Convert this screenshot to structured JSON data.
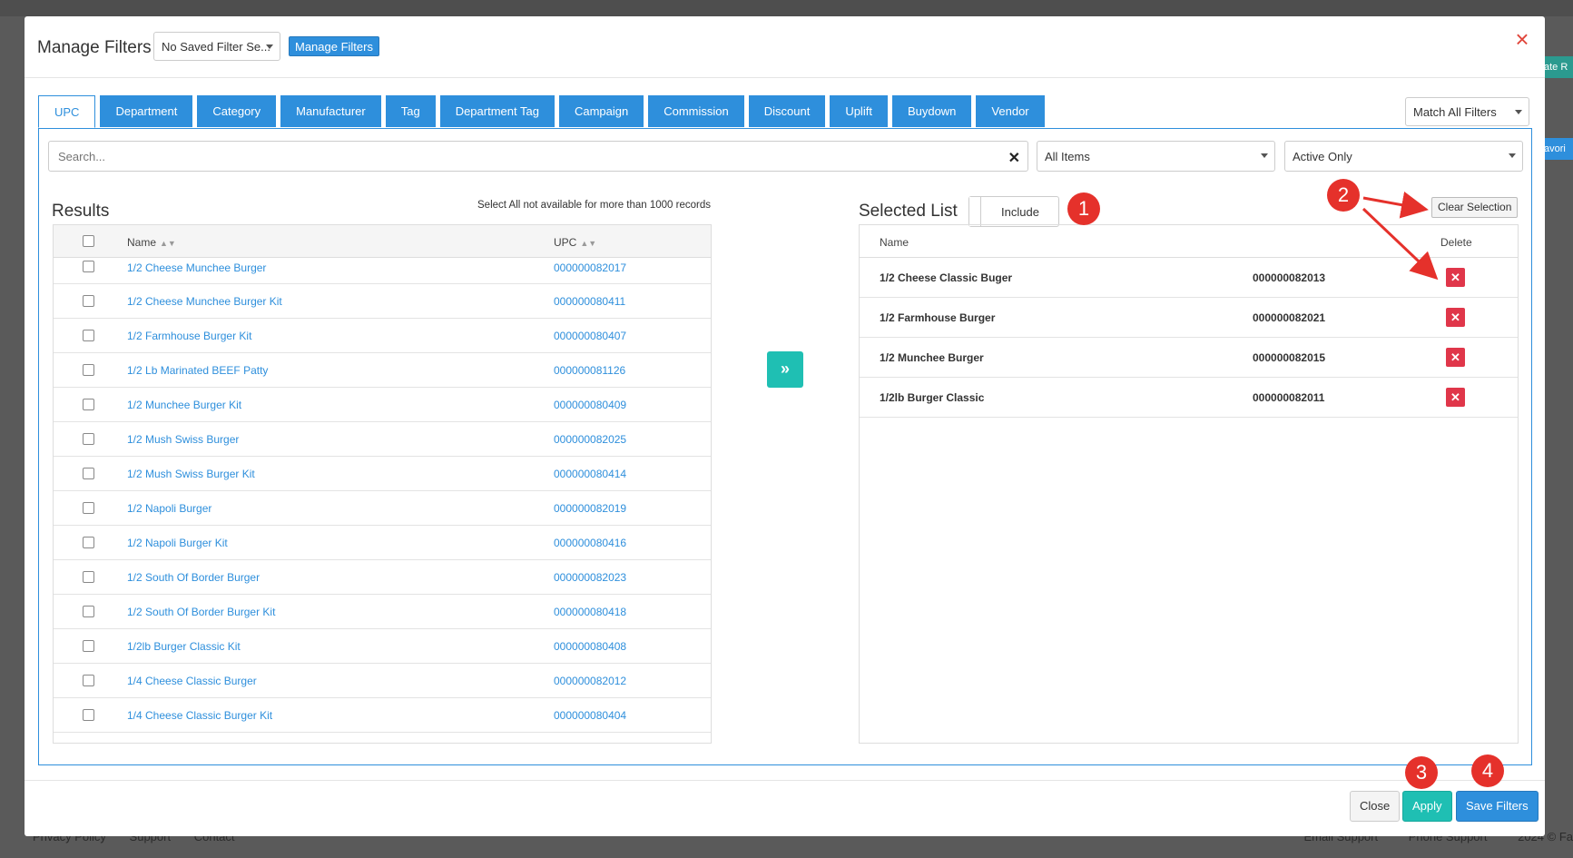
{
  "background": {
    "footer_left": [
      "Privacy Policy",
      "Support",
      "Contact"
    ],
    "footer_right": [
      "Email Support",
      "Phone Support",
      "2024 © Fa"
    ],
    "right_tabs": [
      "ate R",
      "avori"
    ]
  },
  "modal": {
    "title": "Manage Filters",
    "saved_filter_select": "No Saved Filter Se...",
    "manage_button": "Manage Filters",
    "close_icon": "close-icon"
  },
  "tabs": [
    {
      "label": "UPC",
      "active": true
    },
    {
      "label": "Department"
    },
    {
      "label": "Category"
    },
    {
      "label": "Manufacturer"
    },
    {
      "label": "Tag"
    },
    {
      "label": "Department Tag"
    },
    {
      "label": "Campaign"
    },
    {
      "label": "Commission"
    },
    {
      "label": "Discount"
    },
    {
      "label": "Uplift"
    },
    {
      "label": "Buydown"
    },
    {
      "label": "Vendor"
    }
  ],
  "match_select": "Match All Filters",
  "search": {
    "placeholder": "Search...",
    "value": ""
  },
  "items_select": "All Items",
  "status_select": "Active Only",
  "results": {
    "title": "Results",
    "note": "Select All not available for more than 1000 records",
    "columns": {
      "name": "Name",
      "upc": "UPC"
    },
    "rows": [
      {
        "name": "1/2 Cheese Munchee Burger",
        "upc": "000000082017"
      },
      {
        "name": "1/2 Cheese Munchee Burger Kit",
        "upc": "000000080411"
      },
      {
        "name": "1/2 Farmhouse Burger Kit",
        "upc": "000000080407"
      },
      {
        "name": "1/2 Lb Marinated BEEF Patty",
        "upc": "000000081126"
      },
      {
        "name": "1/2 Munchee Burger Kit",
        "upc": "000000080409"
      },
      {
        "name": "1/2 Mush Swiss Burger",
        "upc": "000000082025"
      },
      {
        "name": "1/2 Mush Swiss Burger Kit",
        "upc": "000000080414"
      },
      {
        "name": "1/2 Napoli Burger",
        "upc": "000000082019"
      },
      {
        "name": "1/2 Napoli Burger Kit",
        "upc": "000000080416"
      },
      {
        "name": "1/2 South Of Border Burger",
        "upc": "000000082023"
      },
      {
        "name": "1/2 South Of Border Burger Kit",
        "upc": "000000080418"
      },
      {
        "name": "1/2lb Burger Classic Kit",
        "upc": "000000080408"
      },
      {
        "name": "1/4 Cheese Classic Burger",
        "upc": "000000082012"
      },
      {
        "name": "1/4 Cheese Classic Burger Kit",
        "upc": "000000080404"
      }
    ]
  },
  "move_button_icon": "double-chevron-right-icon",
  "move_button_glyph": "»",
  "selected": {
    "title": "Selected List",
    "toggle_label": "Include",
    "clear_label": "Clear Selection",
    "columns": {
      "name": "Name",
      "delete": "Delete"
    },
    "rows": [
      {
        "name": "1/2 Cheese Classic Buger",
        "upc": "000000082013"
      },
      {
        "name": "1/2 Farmhouse Burger",
        "upc": "000000082021"
      },
      {
        "name": "1/2 Munchee Burger",
        "upc": "000000082015"
      },
      {
        "name": "1/2lb Burger Classic",
        "upc": "000000082011"
      }
    ]
  },
  "annotations": [
    "1",
    "2",
    "3",
    "4"
  ],
  "colors": {
    "primary": "#2e8fdc",
    "teal": "#1fbfb3",
    "danger": "#e0364a",
    "badge": "#e5312b"
  },
  "footer": {
    "close": "Close",
    "apply": "Apply",
    "save": "Save Filters"
  }
}
